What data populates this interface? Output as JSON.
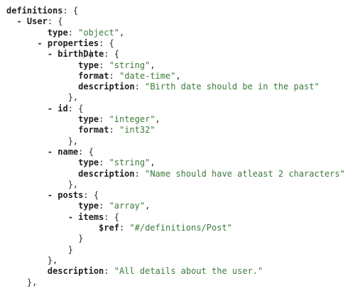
{
  "viewer": {
    "lines": [
      {
        "indent": "",
        "toggle": "",
        "key": "definitions",
        "punc": ": {",
        "value": "",
        "tail": ""
      },
      {
        "indent": "  ",
        "toggle": "- ",
        "key": "User",
        "punc": ": {",
        "value": "",
        "tail": ""
      },
      {
        "indent": "        ",
        "toggle": "",
        "key": "type",
        "punc": ": ",
        "value": "\"object\"",
        "tail": ","
      },
      {
        "indent": "      ",
        "toggle": "- ",
        "key": "properties",
        "punc": ": {",
        "value": "",
        "tail": ""
      },
      {
        "indent": "        ",
        "toggle": "- ",
        "key": "birthDate",
        "punc": ": {",
        "value": "",
        "tail": ""
      },
      {
        "indent": "              ",
        "toggle": "",
        "key": "type",
        "punc": ": ",
        "value": "\"string\"",
        "tail": ","
      },
      {
        "indent": "              ",
        "toggle": "",
        "key": "format",
        "punc": ": ",
        "value": "\"date-time\"",
        "tail": ","
      },
      {
        "indent": "              ",
        "toggle": "",
        "key": "description",
        "punc": ": ",
        "value": "\"Birth date should be in the past\"",
        "tail": ""
      },
      {
        "indent": "            ",
        "toggle": "",
        "key": "",
        "punc": "},",
        "value": "",
        "tail": ""
      },
      {
        "indent": "        ",
        "toggle": "- ",
        "key": "id",
        "punc": ": {",
        "value": "",
        "tail": ""
      },
      {
        "indent": "              ",
        "toggle": "",
        "key": "type",
        "punc": ": ",
        "value": "\"integer\"",
        "tail": ","
      },
      {
        "indent": "              ",
        "toggle": "",
        "key": "format",
        "punc": ": ",
        "value": "\"int32\"",
        "tail": ""
      },
      {
        "indent": "            ",
        "toggle": "",
        "key": "",
        "punc": "},",
        "value": "",
        "tail": ""
      },
      {
        "indent": "        ",
        "toggle": "- ",
        "key": "name",
        "punc": ": {",
        "value": "",
        "tail": ""
      },
      {
        "indent": "              ",
        "toggle": "",
        "key": "type",
        "punc": ": ",
        "value": "\"string\"",
        "tail": ","
      },
      {
        "indent": "              ",
        "toggle": "",
        "key": "description",
        "punc": ": ",
        "value": "\"Name should have atleast 2 characters\"",
        "tail": ""
      },
      {
        "indent": "            ",
        "toggle": "",
        "key": "",
        "punc": "},",
        "value": "",
        "tail": ""
      },
      {
        "indent": "        ",
        "toggle": "- ",
        "key": "posts",
        "punc": ": {",
        "value": "",
        "tail": ""
      },
      {
        "indent": "              ",
        "toggle": "",
        "key": "type",
        "punc": ": ",
        "value": "\"array\"",
        "tail": ","
      },
      {
        "indent": "            ",
        "toggle": "- ",
        "key": "items",
        "punc": ": {",
        "value": "",
        "tail": ""
      },
      {
        "indent": "                  ",
        "toggle": "",
        "key": "$ref",
        "punc": ": ",
        "value": "\"#/definitions/Post\"",
        "tail": ""
      },
      {
        "indent": "              ",
        "toggle": "",
        "key": "",
        "punc": "}",
        "value": "",
        "tail": ""
      },
      {
        "indent": "            ",
        "toggle": "",
        "key": "",
        "punc": "}",
        "value": "",
        "tail": ""
      },
      {
        "indent": "        ",
        "toggle": "",
        "key": "",
        "punc": "},",
        "value": "",
        "tail": ""
      },
      {
        "indent": "        ",
        "toggle": "",
        "key": "description",
        "punc": ": ",
        "value": "\"All details about the user.\"",
        "tail": ""
      },
      {
        "indent": "    ",
        "toggle": "",
        "key": "",
        "punc": "},",
        "value": "",
        "tail": ""
      }
    ]
  },
  "colors": {
    "key": "#1f1f1f",
    "string": "#3b7a3b",
    "background": "#ffffff"
  }
}
